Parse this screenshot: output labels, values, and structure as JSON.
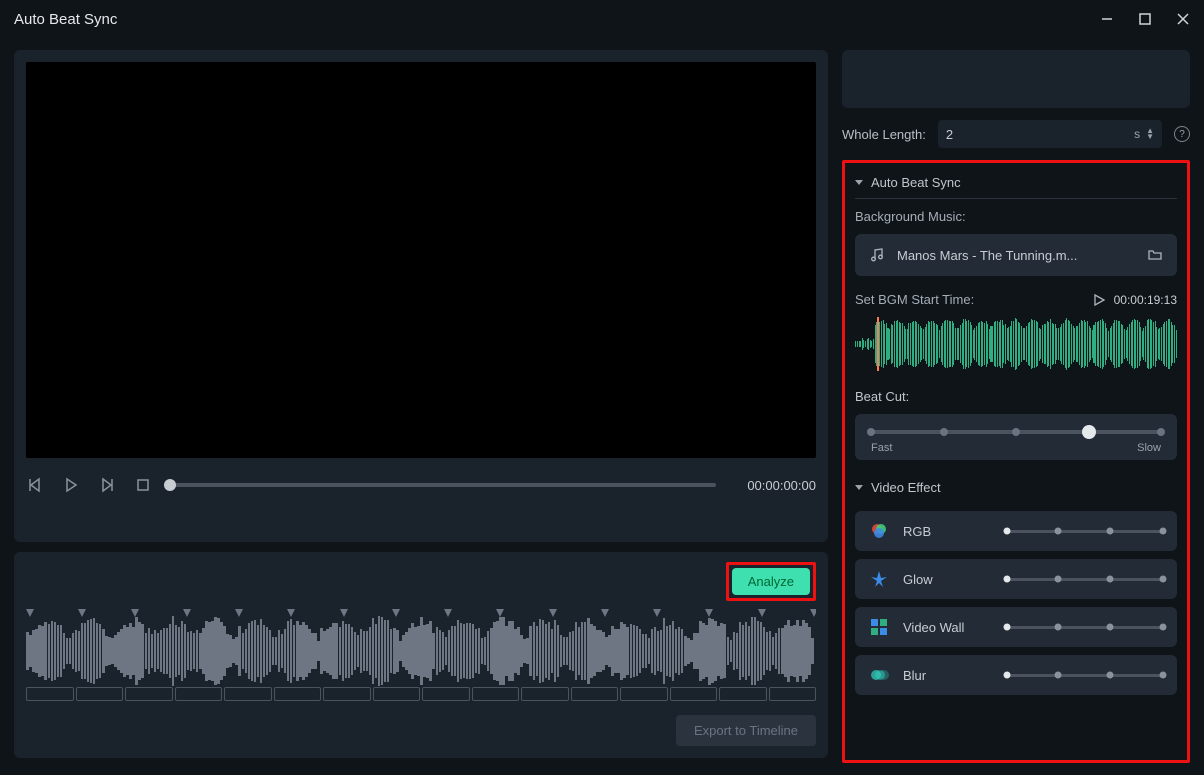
{
  "window": {
    "title": "Auto Beat Sync"
  },
  "preview": {
    "timecode": "00:00:00:00"
  },
  "timeline": {
    "analyze_label": "Analyze",
    "export_label": "Export to Timeline"
  },
  "whole_length": {
    "label": "Whole Length:",
    "value": "2",
    "unit": "s"
  },
  "abs": {
    "section_title": "Auto Beat Sync",
    "bg_music_label": "Background Music:",
    "music_file": "Manos Mars - The Tunning.m...",
    "set_start_label": "Set BGM Start Time:",
    "start_time": "00:00:19:13",
    "beat_cut_label": "Beat Cut:",
    "beat_fast": "Fast",
    "beat_slow": "Slow"
  },
  "video_effect": {
    "section_title": "Video Effect",
    "items": [
      {
        "name": "RGB"
      },
      {
        "name": "Glow"
      },
      {
        "name": "Video Wall"
      },
      {
        "name": "Blur"
      }
    ]
  }
}
